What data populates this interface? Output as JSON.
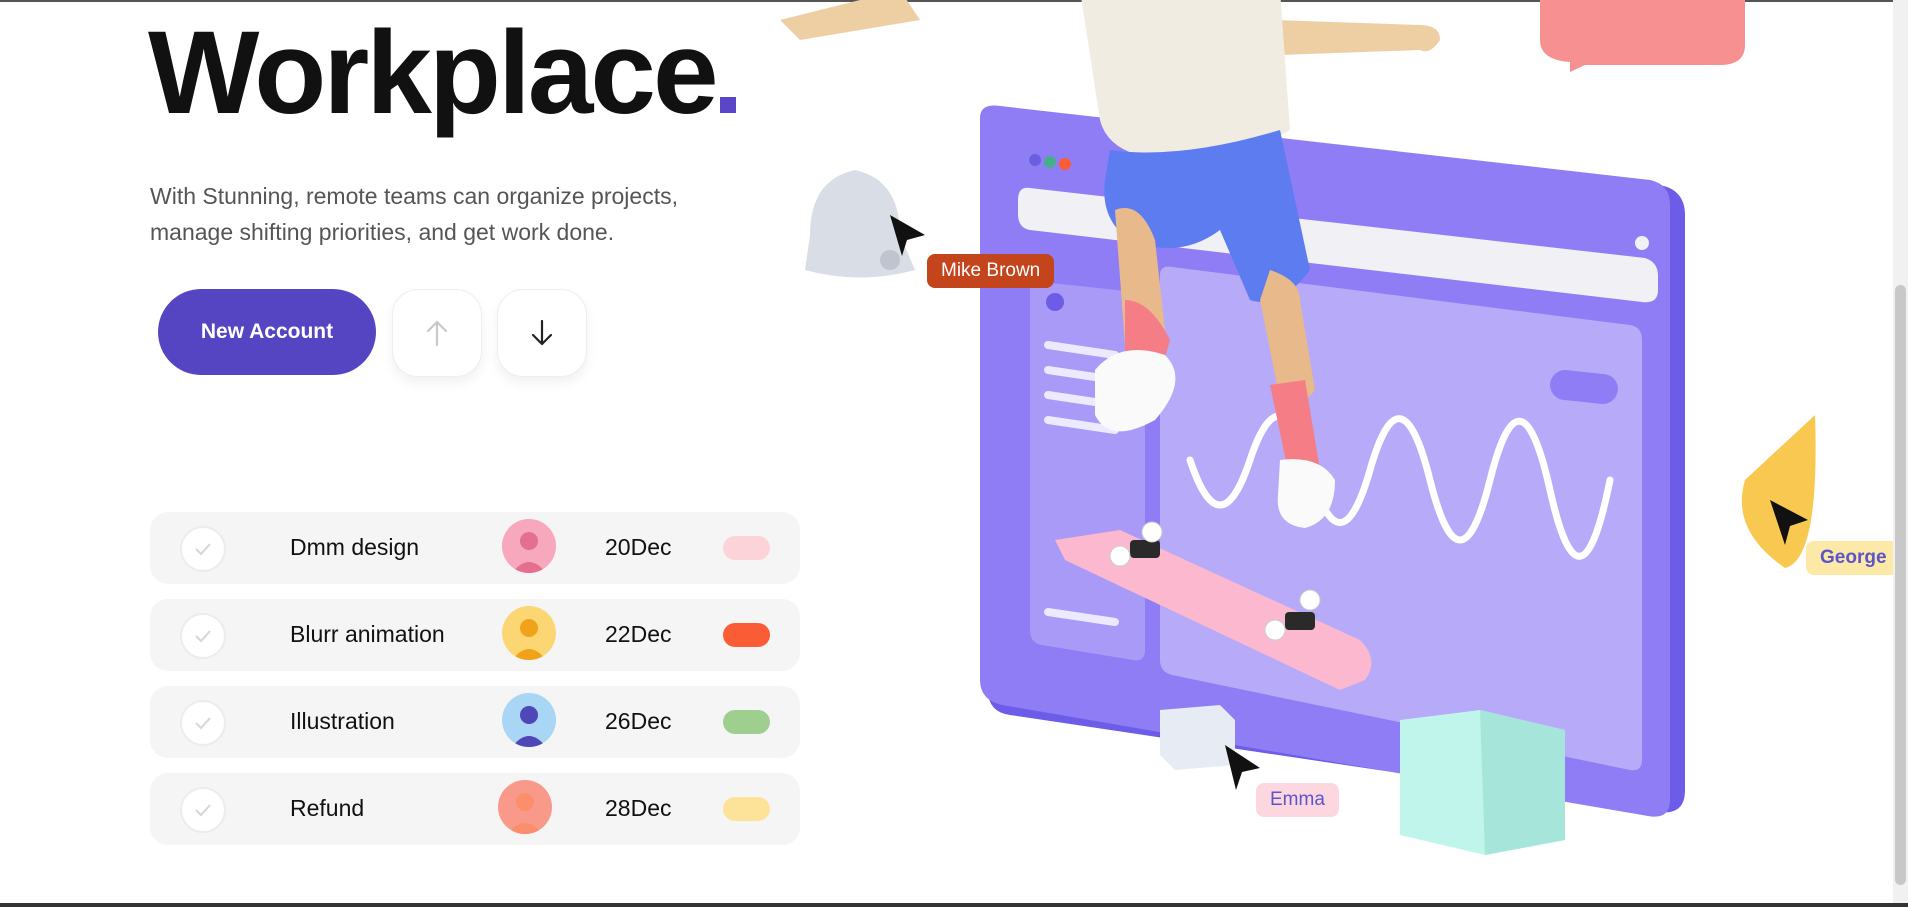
{
  "hero": {
    "title": "Workplace",
    "subtitle_line1": "With Stunning, remote teams can organize projects,",
    "subtitle_line2": "manage shifting priorities, and get work done."
  },
  "actions": {
    "new_account_label": "New Account",
    "scroll_up_icon": "arrow-up-icon",
    "scroll_down_icon": "arrow-down-icon"
  },
  "tasks": [
    {
      "name": "Dmm design",
      "date": "20Dec",
      "tag_color": "#fbd3d9",
      "avatar_bg": "#f7a8bc",
      "avatar_fg": "#e46f8e"
    },
    {
      "name": "Blurr animation",
      "date": "22Dec",
      "tag_color": "#fa5c35",
      "avatar_bg": "#fdd674",
      "avatar_fg": "#f0a21a"
    },
    {
      "name": "Illustration",
      "date": "26Dec",
      "tag_color": "#9fcf8e",
      "avatar_bg": "#a9d6f5",
      "avatar_fg": "#4f47b7"
    },
    {
      "name": "Refund",
      "date": "28Dec",
      "tag_color": "#fde29a",
      "avatar_bg": "#f9998a",
      "avatar_fg": "#fb8f6c"
    }
  ],
  "illustration": {
    "tags": {
      "mike": "Mike Brown",
      "george": "George",
      "emma": "Emma"
    }
  },
  "colors": {
    "accent": "#5645c2",
    "screen": "#8f7df5"
  }
}
